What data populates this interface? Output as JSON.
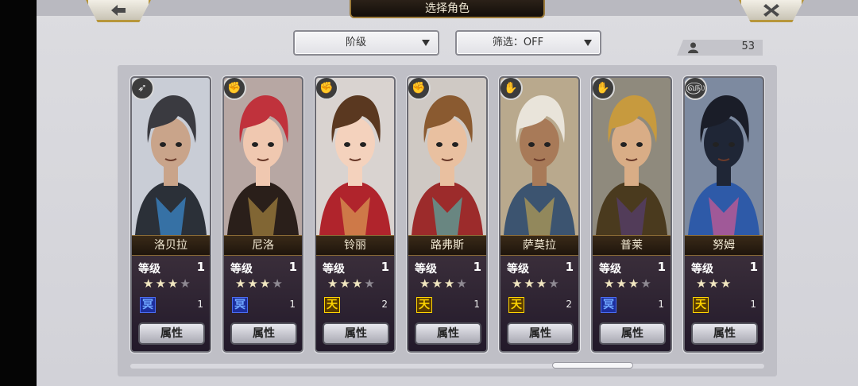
{
  "header": {
    "title": "选择角色",
    "back_icon": "arrow-left-icon",
    "close_icon": "close-icon"
  },
  "toolbar": {
    "sort_dropdown": "阶级",
    "filter_dropdown": "筛选：OFF",
    "character_count": "53"
  },
  "colors": {
    "accent_gold": "#b7963b",
    "title_plate": "#1a130d",
    "panel": "#bfbfc6",
    "star_on": "#f1e6c0",
    "star_off": "#8f8a93"
  },
  "cards": [
    {
      "name": "洛贝拉",
      "level_label": "等级",
      "level": "1",
      "stars_filled": 3,
      "stars_total": 4,
      "sky_rank": "冥",
      "sky_color": "blue",
      "sky_count": "1",
      "button": "属性",
      "class_icon": "bow-icon",
      "class_glyph": "➶"
    },
    {
      "name": "尼洛",
      "level_label": "等级",
      "level": "1",
      "stars_filled": 3,
      "stars_total": 4,
      "sky_rank": "冥",
      "sky_color": "blue",
      "sky_count": "1",
      "button": "属性",
      "class_icon": "fist-icon",
      "class_glyph": "✊"
    },
    {
      "name": "铃丽",
      "level_label": "等级",
      "level": "1",
      "stars_filled": 3,
      "stars_total": 4,
      "sky_rank": "天",
      "sky_color": "gold",
      "sky_count": "2",
      "button": "属性",
      "class_icon": "fist-icon",
      "class_glyph": "✊"
    },
    {
      "name": "路弗斯",
      "level_label": "等级",
      "level": "1",
      "stars_filled": 3,
      "stars_total": 4,
      "sky_rank": "天",
      "sky_color": "gold",
      "sky_count": "1",
      "button": "属性",
      "class_icon": "fist-icon",
      "class_glyph": "✊"
    },
    {
      "name": "萨莫拉",
      "level_label": "等级",
      "level": "1",
      "stars_filled": 3,
      "stars_total": 4,
      "sky_rank": "天",
      "sky_color": "gold",
      "sky_count": "2",
      "button": "属性",
      "class_icon": "gauntlet-icon",
      "class_glyph": "✋"
    },
    {
      "name": "普莱",
      "level_label": "等级",
      "level": "1",
      "stars_filled": 3,
      "stars_total": 4,
      "sky_rank": "冥",
      "sky_color": "blue",
      "sky_count": "1",
      "button": "属性",
      "class_icon": "gauntlet-icon",
      "class_glyph": "✋"
    },
    {
      "name": "努姆",
      "level_label": "等级",
      "level": "1",
      "stars_filled": 3,
      "stars_total": 3,
      "sky_rank": "天",
      "sky_color": "gold",
      "sky_count": "1",
      "button": "属性",
      "class_icon": "swirl-icon",
      "class_glyph": "௵"
    }
  ],
  "portraits": [
    {
      "bg": "#c9cdd6",
      "hair": "#3a3a40",
      "skin": "#c9a48a",
      "outfit": "#2b3038",
      "accent": "#3fa7ff"
    },
    {
      "bg": "#b7a7a3",
      "hair": "#c0323c",
      "skin": "#f0c8b0",
      "outfit": "#2a1f1a",
      "accent": "#c8a14a"
    },
    {
      "bg": "#d9d3d0",
      "hair": "#5a3820",
      "skin": "#f4d2bd",
      "outfit": "#b0242c",
      "accent": "#e8c060"
    },
    {
      "bg": "#cfc9c4",
      "hair": "#8a5a30",
      "skin": "#e9c0a0",
      "outfit": "#9c2b2b",
      "accent": "#3fd2c8"
    },
    {
      "bg": "#b9a98d",
      "hair": "#e9e4da",
      "skin": "#a87a58",
      "outfit": "#3c5470",
      "accent": "#d9b34c"
    },
    {
      "bg": "#8f8a7d",
      "hair": "#c79a3e",
      "skin": "#d9ad86",
      "outfit": "#4a3a1e",
      "accent": "#5a3e8a"
    },
    {
      "bg": "#7d8aa0",
      "hair": "#1a1d28",
      "skin": "#1f2636",
      "outfit": "#2e5aa8",
      "accent": "#ff5a8a"
    }
  ]
}
